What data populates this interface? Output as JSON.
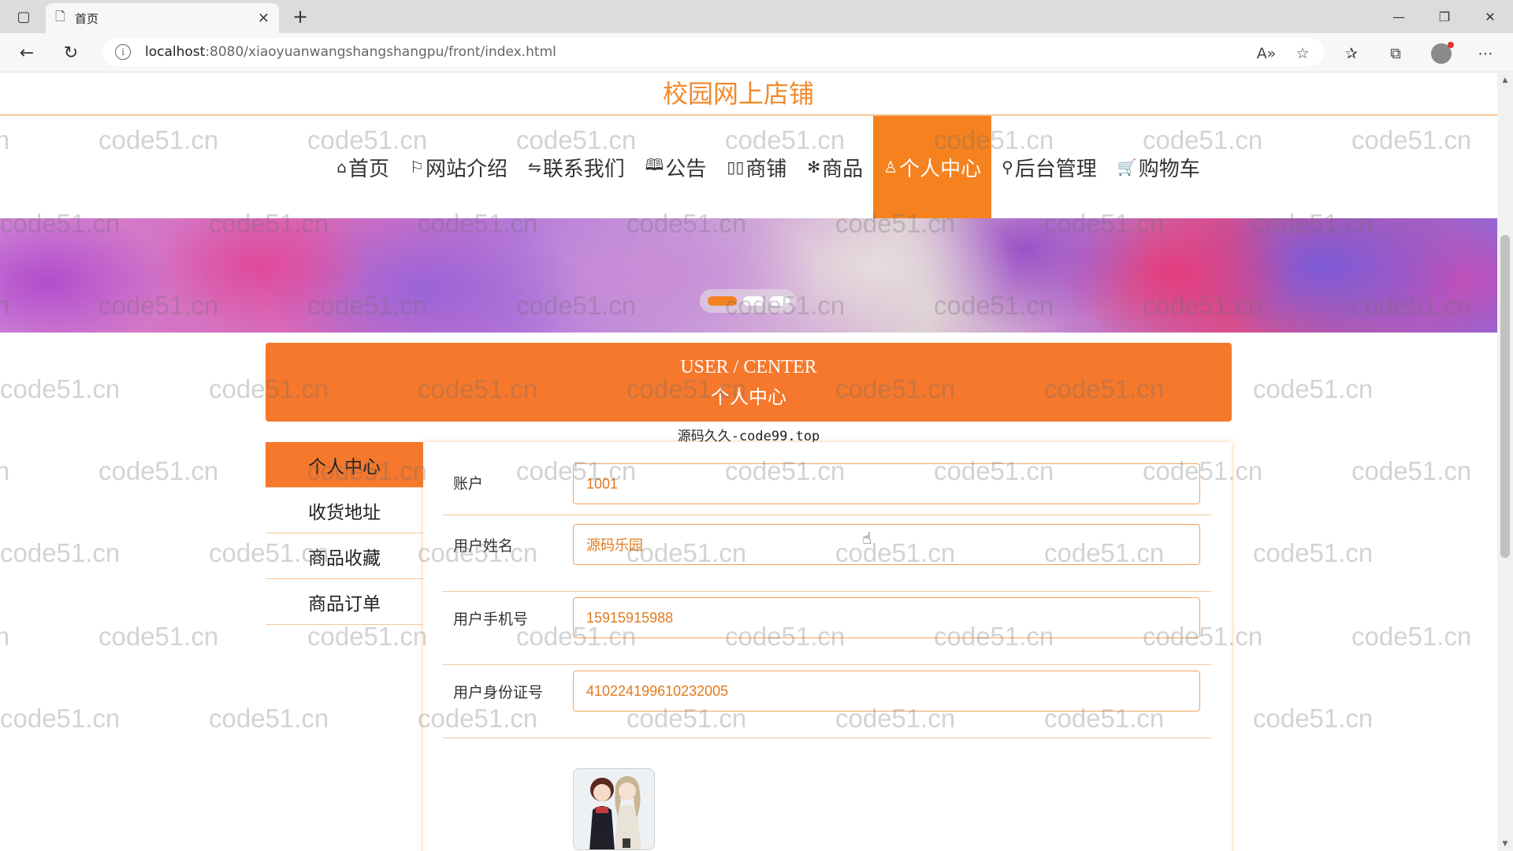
{
  "browser": {
    "tab_title": "首页",
    "url_host": "localhost",
    "url_path": ":8080/xiaoyuanwangshangshangpu/front/index.html",
    "icons": [
      "sidebar-toggle-icon",
      "page-icon",
      "close-icon",
      "plus-icon",
      "minimize-icon",
      "restore-icon",
      "close-icon",
      "back-arrow-icon",
      "refresh-icon",
      "info-icon",
      "read-aloud-icon",
      "add-favorite-icon",
      "favorites-icon",
      "collections-icon",
      "profile-icon",
      "more-icon"
    ]
  },
  "watermark": "code51.cn",
  "site": {
    "title": "校园网上店铺"
  },
  "nav": {
    "items": [
      {
        "icon": "⌂",
        "label": "首页"
      },
      {
        "icon": "⚐",
        "label": "网站介绍"
      },
      {
        "icon": "⇋",
        "label": "联系我们"
      },
      {
        "icon": "🕮",
        "label": "公告"
      },
      {
        "icon": "▯▯",
        "label": "商铺"
      },
      {
        "icon": "✻",
        "label": "商品"
      },
      {
        "icon": "♙",
        "label": "个人中心"
      },
      {
        "icon": "⚲",
        "label": "后台管理"
      },
      {
        "icon": "🛒",
        "label": "购物车"
      }
    ],
    "active_index": 6
  },
  "banner": {
    "slide_count": 3,
    "active_slide": 0
  },
  "user_center": {
    "title_en": "USER / CENTER",
    "title_cn": "个人中心",
    "subtitle": "源码久久-code99.top"
  },
  "sidebar": {
    "items": [
      "个人中心",
      "收货地址",
      "商品收藏",
      "商品订单"
    ],
    "active_index": 0
  },
  "form": {
    "account_label": "账户",
    "account_value": "1001",
    "name_label": "用户姓名",
    "name_value": "源码乐园",
    "phone_label": "用户手机号",
    "phone_value": "15915915988",
    "idcard_label": "用户身份证号",
    "idcard_value": "410224199610232005"
  },
  "colors": {
    "accent": "#f5821f",
    "header_orange": "#f5782c",
    "title_orange": "#f08a2c"
  }
}
